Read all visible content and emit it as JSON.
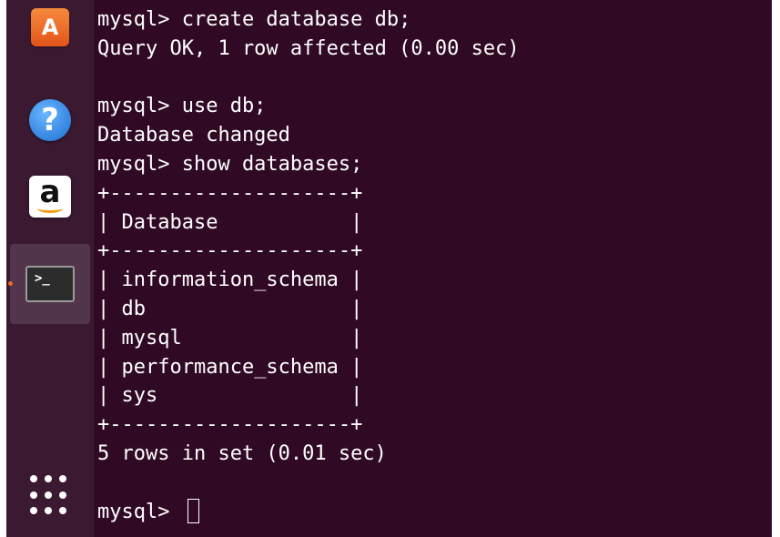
{
  "launcher": {
    "items": [
      {
        "name": "ubuntu-software-icon",
        "glyph": "A"
      },
      {
        "name": "help-icon",
        "glyph": "?"
      },
      {
        "name": "amazon-icon",
        "glyph": "a"
      },
      {
        "name": "terminal-icon",
        "glyph": ">_"
      }
    ]
  },
  "terminal": {
    "lines": [
      "mysql> create database db;",
      "Query OK, 1 row affected (0.00 sec)",
      "",
      "mysql> use db;",
      "Database changed",
      "mysql> show databases;",
      "+--------------------+",
      "| Database           |",
      "+--------------------+",
      "| information_schema |",
      "| db                 |",
      "| mysql              |",
      "| performance_schema |",
      "| sys                |",
      "+--------------------+",
      "5 rows in set (0.01 sec)",
      ""
    ],
    "prompt": "mysql> "
  },
  "colors": {
    "terminal_background": "#300a24",
    "launcher_background": "#3b1a31",
    "text": "#ffffff"
  }
}
